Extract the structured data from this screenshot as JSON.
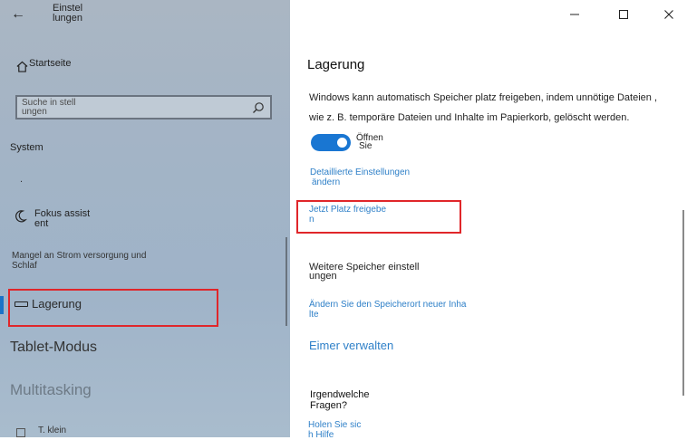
{
  "window": {
    "title": "Einstel lungen",
    "back_icon": "back-arrow-icon",
    "minimize_icon": "minimize-icon",
    "maximize_icon": "maximize-icon",
    "close_icon": "close-icon"
  },
  "sidebar": {
    "home_label": "Startseite",
    "search_placeholder": "Suche in stell ungen",
    "section_label": "System",
    "dot_item": ".",
    "items": [
      {
        "label": "Fokus assist ent",
        "icon": "moon-icon"
      },
      {
        "label": "Mangel an Strom versorgung und Schlaf"
      },
      {
        "label": "Lagerung",
        "icon": "storage-icon",
        "selected": true
      },
      {
        "label": "Tablet-Modus"
      },
      {
        "label": "Multitasking"
      },
      {
        "label": "T. klein"
      }
    ]
  },
  "main": {
    "heading": "Lagerung",
    "description": "Windows kann automatisch Speicher platz freigeben, indem unnötige Dateien , wie z. B. temporäre Dateien und Inhalte im Papierkorb, gelöscht werden.",
    "toggle": {
      "state": "on",
      "label_line1": "Öffnen",
      "label_line2": "Sie"
    },
    "detail_link_line1": "Detaillierte Einstellungen",
    "detail_link_line2": "ändern",
    "free_link_line1": "Jetzt Platz freigebe",
    "free_link_line2": "n",
    "more_heading": "Weitere Speicher einstell ungen",
    "change_link_line1": "Ändern Sie den Speicherort neuer Inha",
    "change_link_line2": "lte",
    "manage_link": "Eimer verwalten",
    "questions": "Irgendwelche Fragen?",
    "help_link_line1": "Holen Sie sic",
    "help_link_line2": "h Hilfe"
  },
  "colors": {
    "accent": "#1976d2",
    "link": "#2f80c8",
    "highlight": "#e0262a",
    "sidebar_bg": "#a3b4c6"
  }
}
